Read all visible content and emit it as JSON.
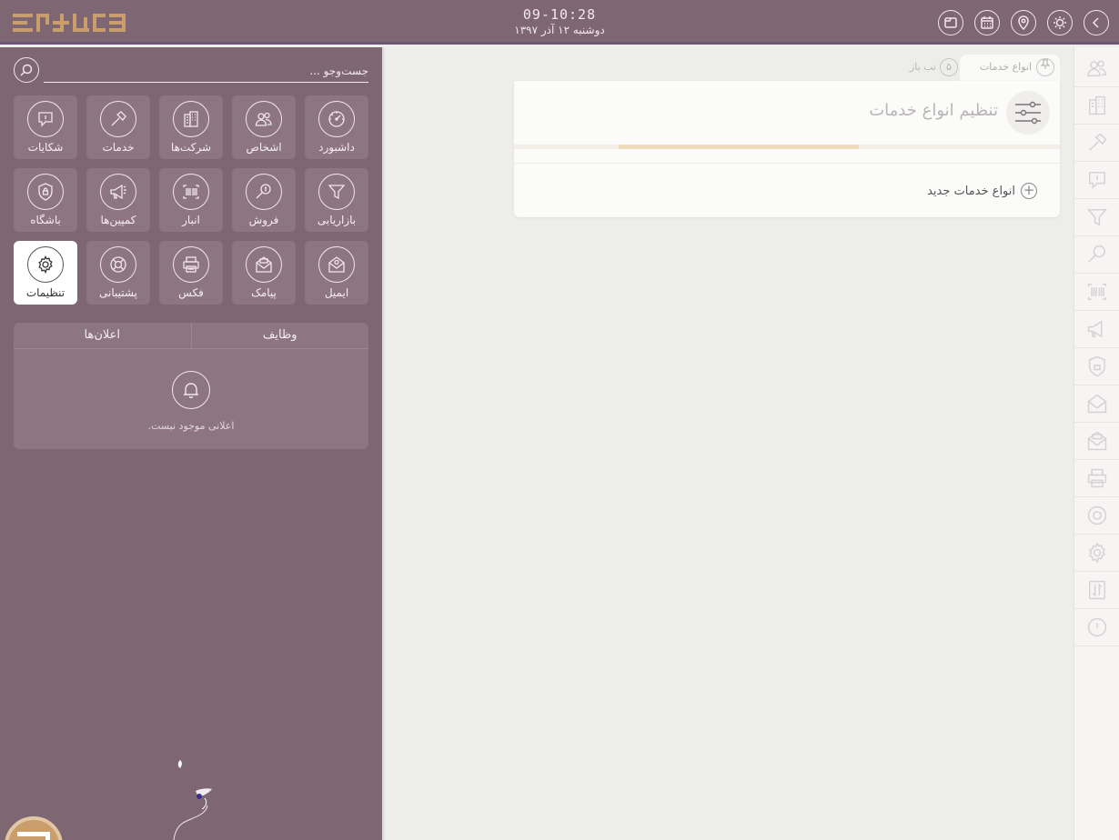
{
  "header": {
    "clock_time": "09-10:28",
    "clock_date": "دوشنبه ۱۲ آذر ۱۳۹۷",
    "buttons": [
      "back-icon",
      "brightness-icon",
      "location-icon",
      "calendar-icon",
      "window-icon"
    ]
  },
  "search": {
    "placeholder": "جست‌وجو ..."
  },
  "tiles": [
    {
      "label": "داشبورد",
      "icon": "dashboard-icon"
    },
    {
      "label": "اشخاص",
      "icon": "people-icon"
    },
    {
      "label": "شرکت‌ها",
      "icon": "buildings-icon"
    },
    {
      "label": "خدمات",
      "icon": "hammer-icon"
    },
    {
      "label": "شکایات",
      "icon": "complaint-icon"
    },
    {
      "label": "بازاریابی",
      "icon": "funnel-icon"
    },
    {
      "label": "فروش",
      "icon": "sales-icon"
    },
    {
      "label": "انبار",
      "icon": "barcode-icon"
    },
    {
      "label": "کمپین‌ها",
      "icon": "megaphone-icon"
    },
    {
      "label": "باشگاه",
      "icon": "shield-lock-icon"
    },
    {
      "label": "ایمیل",
      "icon": "email-icon"
    },
    {
      "label": "پیامک",
      "icon": "sms-icon"
    },
    {
      "label": "فکس",
      "icon": "printer-icon"
    },
    {
      "label": "پشتیبانی",
      "icon": "lifebuoy-icon"
    },
    {
      "label": "تنظیمات",
      "icon": "gear-icon",
      "active": true
    }
  ],
  "notifications": {
    "tab_tasks": "وظایف",
    "tab_announcements": "اعلان‌ها",
    "empty_text": "اعلانی موجود نیست."
  },
  "main": {
    "tab_active_label": "انواع خدمات",
    "tab_open_count": "۵",
    "tab_open_label": "تب باز",
    "card_title": "تنظیم انواع خدمات",
    "new_button_label": "انواع خدمات جدید",
    "progress_fraction": 0.44
  },
  "strip_icons": [
    "people-icon",
    "buildings-icon",
    "hammer-icon",
    "complaint-icon",
    "funnel-icon",
    "sales-icon",
    "barcode-icon",
    "megaphone-icon",
    "shield-lock-icon",
    "email-icon",
    "sms-icon",
    "printer-icon",
    "lifebuoy-icon",
    "gear-icon",
    "swap-icon",
    "power-icon"
  ],
  "colors": {
    "panel": "#7e6672",
    "tile": "#8d7681",
    "accent_gold": "#c99e6a",
    "progress": "#efdcbb",
    "background": "#ededeb"
  }
}
